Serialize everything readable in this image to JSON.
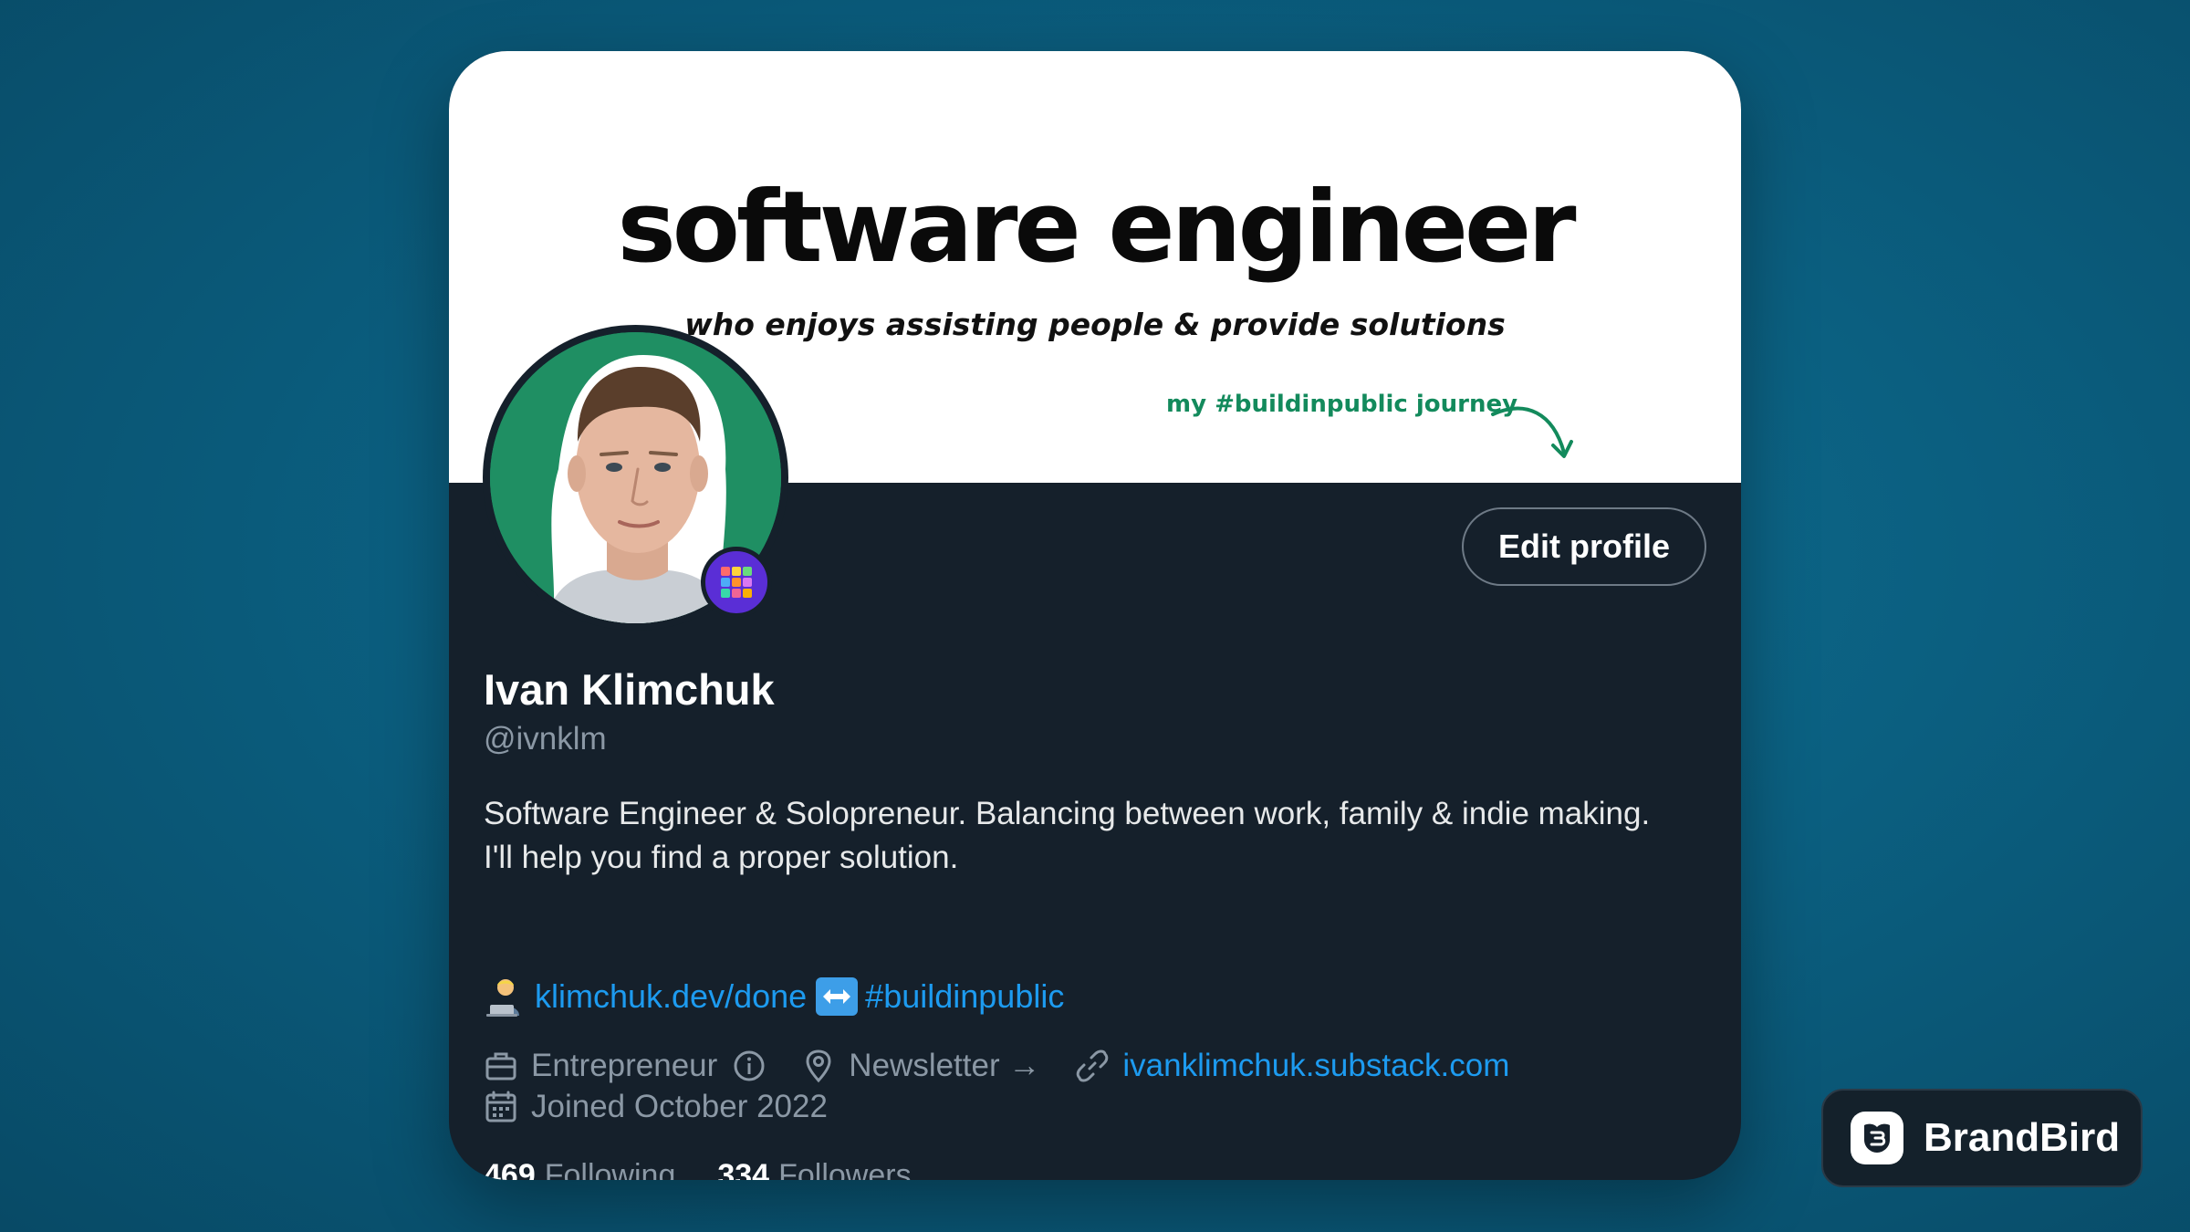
{
  "banner": {
    "title": "software engineer",
    "subtitle": "who enjoys assisting people & provide solutions",
    "note": "my #buildinpublic journey"
  },
  "profile": {
    "name": "Ivan Klimchuk",
    "handle": "@ivnklm",
    "bio_line1": "Software Engineer & Solopreneur. Balancing between work, family & indie making.",
    "bio_line2": "I'll help you find a proper solution.",
    "edit_label": "Edit profile"
  },
  "bio_links": {
    "link1": "klimchuk.dev/done",
    "link2": "#buildinpublic"
  },
  "meta": {
    "category": "Entrepreneur",
    "location": "Newsletter →",
    "website": "ivanklimchuk.substack.com",
    "joined": "Joined October 2022"
  },
  "stats": {
    "following_count": "469",
    "following_label": "Following",
    "followers_count": "334",
    "followers_label": "Followers"
  },
  "watermark": {
    "label": "BrandBird"
  },
  "colors": {
    "background": "#0b5f80",
    "card": "#15202b",
    "link": "#1d9bf0",
    "muted": "#8b98a5",
    "banner_accent": "#138a5c"
  },
  "icons": {
    "avatar_badge": "grid-badge-icon",
    "category": "briefcase-icon",
    "info": "info-circle-icon",
    "location": "location-pin-icon",
    "website": "link-icon",
    "joined": "calendar-icon"
  }
}
